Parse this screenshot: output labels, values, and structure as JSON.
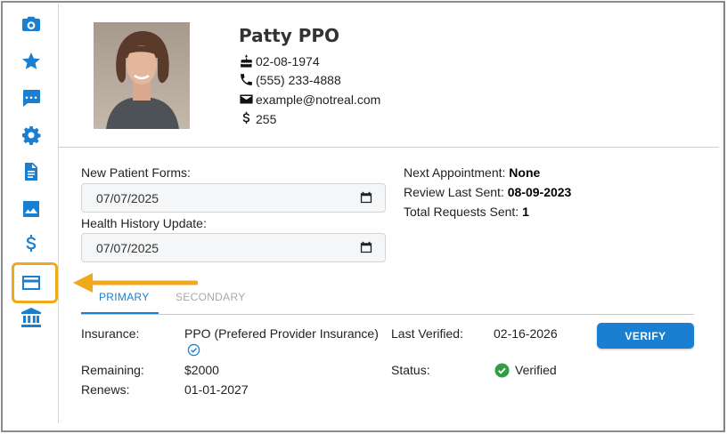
{
  "sidebar": {
    "icons": [
      "camera-icon",
      "star-icon",
      "chat-icon",
      "gear-icon",
      "document-icon",
      "image-icon",
      "dollar-icon",
      "credit-card-icon",
      "bank-icon"
    ],
    "accent_color": "#1a7fd0",
    "highlight_color": "#f0a81c"
  },
  "patient": {
    "name": "Patty PPO",
    "birthdate": "02-08-1974",
    "phone": "(555) 233-4888",
    "email": "example@notreal.com",
    "balance": "255"
  },
  "forms": {
    "new_patient_label": "New Patient Forms:",
    "new_patient_date": "07/07/2025",
    "health_history_label": "Health History Update:",
    "health_history_date": "07/07/2025"
  },
  "appointments": {
    "next_label": "Next Appointment: ",
    "next_value": "None",
    "review_label": "Review Last Sent: ",
    "review_value": "08-09-2023",
    "requests_label": "Total Requests Sent: ",
    "requests_value": "1"
  },
  "tabs": {
    "primary": "PRIMARY",
    "secondary": "SECONDARY"
  },
  "insurance": {
    "insurance_label": "Insurance:",
    "insurance_value": "PPO (Prefered Provider Insurance)",
    "remaining_label": "Remaining:",
    "remaining_value": "$2000",
    "renews_label": "Renews:",
    "renews_value": "01-01-2027",
    "last_verified_label": "Last Verified:",
    "last_verified_value": "02-16-2026",
    "status_label": "Status:",
    "status_value": "Verified",
    "verify_button": "VERIFY"
  }
}
